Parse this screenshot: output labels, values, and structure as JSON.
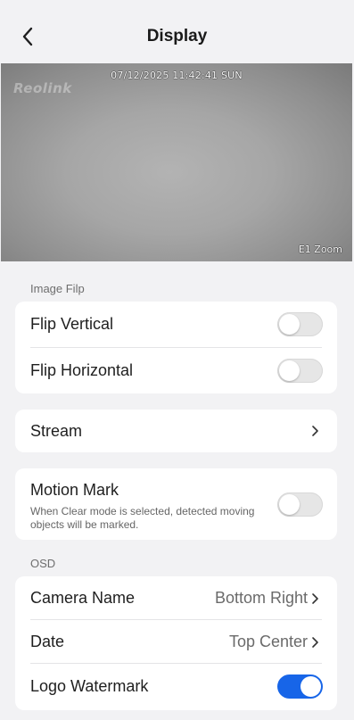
{
  "header": {
    "title": "Display"
  },
  "preview": {
    "timestamp": "07/12/2025 11:42:41 SUN",
    "logo_text": "Reolink",
    "model_label": "E1 Zoom"
  },
  "image_flip": {
    "section_label": "Image Filp",
    "flip_vertical": {
      "label": "Flip Vertical",
      "enabled": false
    },
    "flip_horizontal": {
      "label": "Flip Horizontal",
      "enabled": false
    }
  },
  "stream": {
    "label": "Stream"
  },
  "motion_mark": {
    "label": "Motion Mark",
    "description": "When Clear mode is selected, detected moving objects will be marked.",
    "enabled": false
  },
  "osd": {
    "section_label": "OSD",
    "camera_name": {
      "label": "Camera Name",
      "value": "Bottom Right"
    },
    "date": {
      "label": "Date",
      "value": "Top Center"
    },
    "logo_watermark": {
      "label": "Logo Watermark",
      "enabled": true
    }
  },
  "colors": {
    "accent": "#1765e8",
    "background": "#f2f2f4",
    "card": "#ffffff"
  },
  "icons": {
    "back": "chevron-left-icon",
    "row_arrow": "chevron-right-icon"
  }
}
